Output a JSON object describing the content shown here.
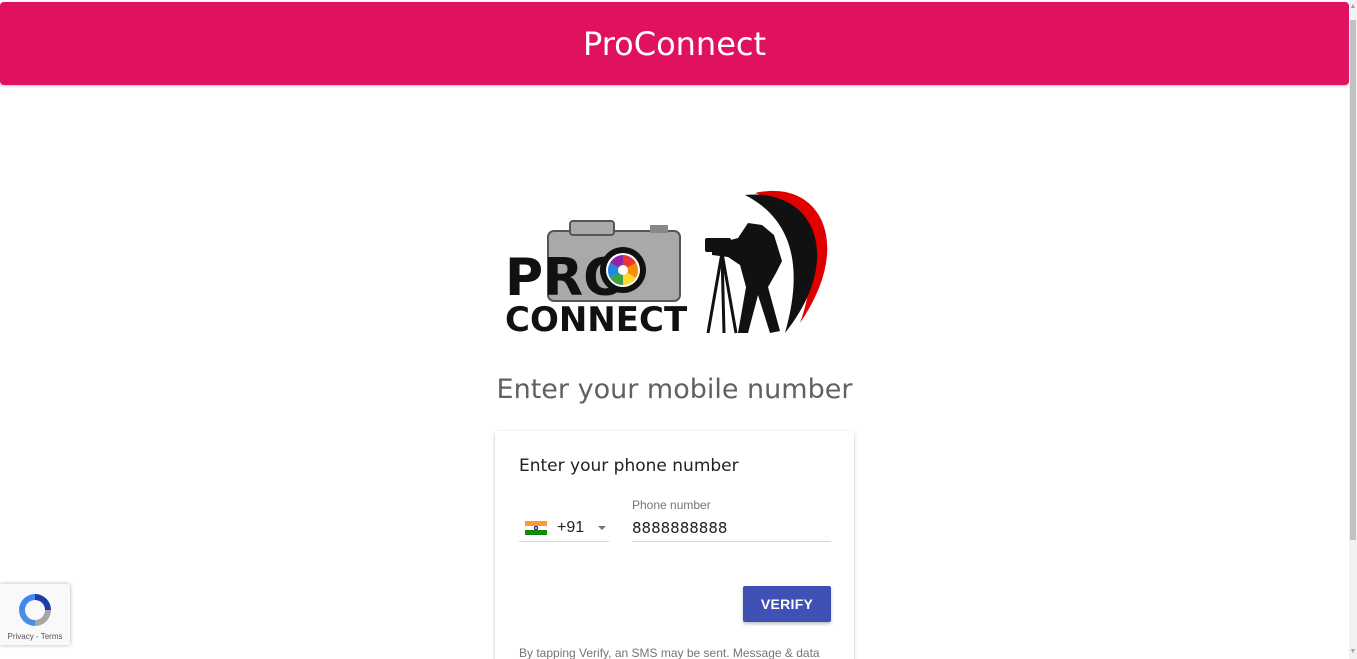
{
  "header": {
    "title": "ProConnect"
  },
  "logo": {
    "line1": "PRO",
    "line2": "CONNECT"
  },
  "main": {
    "heading": "Enter your mobile number"
  },
  "card": {
    "title": "Enter your phone number",
    "country": {
      "dial_code": "+91",
      "flag": "india-flag-icon"
    },
    "phone": {
      "label": "Phone number",
      "value": "8888888888"
    },
    "verify_label": "VERIFY",
    "disclaimer": "By tapping Verify, an SMS may be sent. Message & data"
  },
  "recaptcha": {
    "privacy": "Privacy",
    "separator": " - ",
    "terms": "Terms"
  },
  "colors": {
    "header": "#e0115f",
    "button": "#3f51b5"
  }
}
